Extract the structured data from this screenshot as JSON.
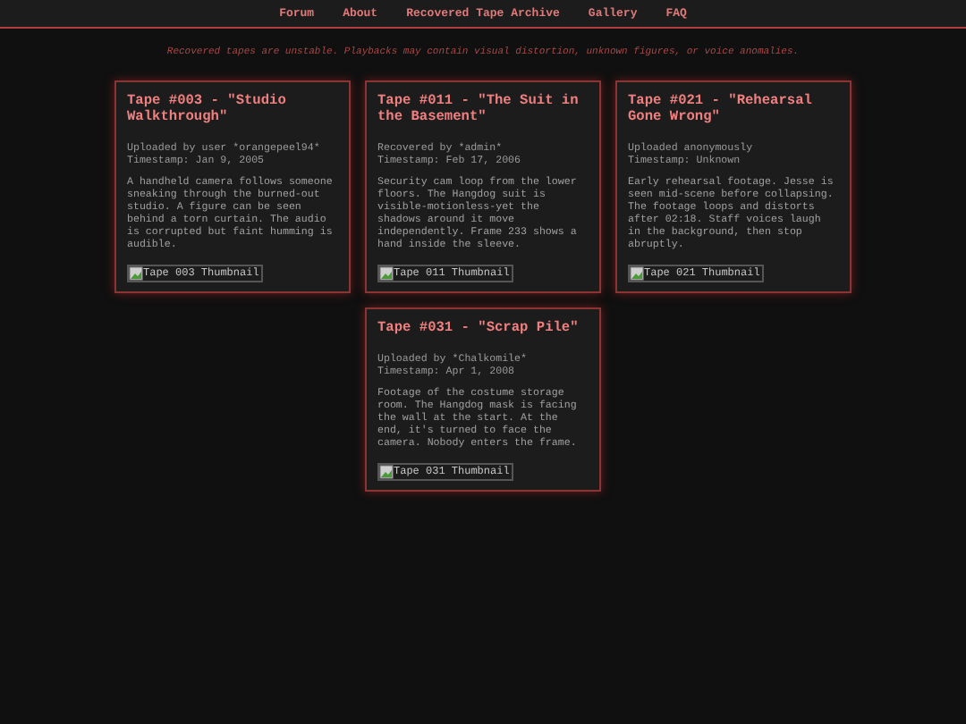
{
  "nav": [
    {
      "label": "Forum"
    },
    {
      "label": "About"
    },
    {
      "label": "Recovered Tape Archive"
    },
    {
      "label": "Gallery"
    },
    {
      "label": "FAQ"
    }
  ],
  "notice": "Recovered tapes are unstable. Playbacks may contain visual distortion, unknown figures, or voice anomalies.",
  "tapes": [
    {
      "title": "Tape #003 - \"Studio Walkthrough\"",
      "meta": [
        "Uploaded by user *orangepeel94*",
        "Timestamp: Jan 9, 2005"
      ],
      "description": "A handheld camera follows someone sneaking through the burned-out studio. A figure can be seen behind a torn curtain. The audio is corrupted but faint humming is audible.",
      "thumbnail": "Tape 003 Thumbnail"
    },
    {
      "title": "Tape #011 - \"The Suit in the Basement\"",
      "meta": [
        "Recovered by *admin*",
        "Timestamp: Feb 17, 2006"
      ],
      "description": "Security cam loop from the lower floors. The Hangdog suit is visible-motionless-yet the shadows around it move independently. Frame 233 shows a hand inside the sleeve.",
      "thumbnail": "Tape 011 Thumbnail"
    },
    {
      "title": "Tape #021 - \"Rehearsal Gone Wrong\"",
      "meta": [
        "Uploaded anonymously",
        "Timestamp: Unknown"
      ],
      "description": "Early rehearsal footage. Jesse is seen mid-scene before collapsing. The footage loops and distorts after 02:18. Staff voices laugh in the background, then stop abruptly.",
      "thumbnail": "Tape 021 Thumbnail"
    },
    {
      "title": "Tape #031 - \"Scrap Pile\"",
      "meta": [
        "Uploaded by *Chalkomile*",
        "Timestamp: Apr 1, 2008"
      ],
      "description": "Footage of the costume storage room. The Hangdog mask is facing the wall at the start. At the end, it's turned to face the camera. Nobody enters the frame.",
      "thumbnail": "Tape 031 Thumbnail"
    }
  ]
}
